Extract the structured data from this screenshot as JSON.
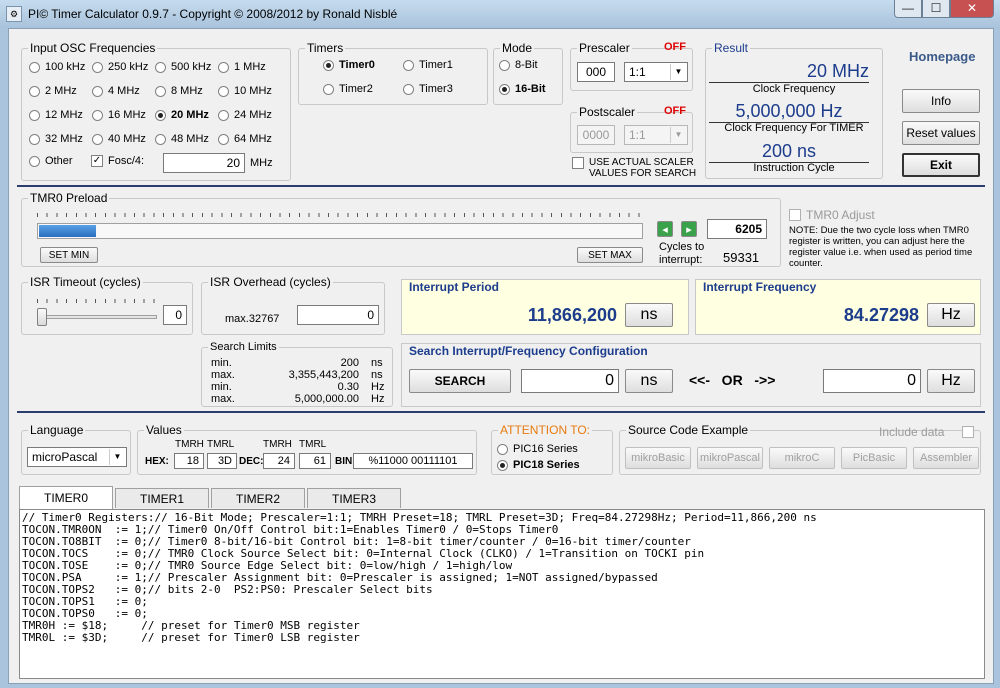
{
  "window": {
    "title": "PI© Timer Calculator 0.9.7 - Copyright © 2008/2012 by Ronald Nisblé",
    "min": "—",
    "max": "☐",
    "close": "✕"
  },
  "osc": {
    "legend": "Input OSC Frequencies",
    "options": [
      "100 kHz",
      "250 kHz",
      "500 kHz",
      "1 MHz",
      "2 MHz",
      "4 MHz",
      "8 MHz",
      "10 MHz",
      "12 MHz",
      "16 MHz",
      "20 MHz",
      "24 MHz",
      "32 MHz",
      "40 MHz",
      "48 MHz",
      "64 MHz"
    ],
    "selected": "20 MHz",
    "other_label": "Other",
    "fosc_label": "Fosc/4:",
    "fosc_checked": true,
    "other_value": "20",
    "other_unit": "MHz"
  },
  "timers": {
    "legend": "Timers",
    "options": [
      "Timer0",
      "Timer1",
      "Timer2",
      "Timer3"
    ],
    "selected": "Timer0"
  },
  "mode": {
    "legend": "Mode",
    "options": [
      "8-Bit",
      "16-Bit"
    ],
    "selected": "16-Bit"
  },
  "prescaler": {
    "legend": "Prescaler",
    "state": "OFF",
    "value": "000",
    "ratio": "1:1"
  },
  "postscaler": {
    "legend": "Postscaler",
    "state": "OFF",
    "value": "0000",
    "ratio": "1:1"
  },
  "use_actual": {
    "line1": "USE ACTUAL SCALER",
    "line2": "VALUES FOR SEARCH"
  },
  "result": {
    "legend": "Result",
    "clock_value": "20",
    "clock_unit": "MHz",
    "clock_label": "Clock Frequency",
    "timer_clock_value": "5,000,000",
    "timer_clock_unit": "Hz",
    "timer_clock_label": "Clock Frequency For TIMER",
    "cycle_value": "200",
    "cycle_unit": "ns",
    "cycle_label": "Instruction Cycle"
  },
  "side": {
    "homepage": "Homepage",
    "info": "Info",
    "reset": "Reset values",
    "exit": "Exit"
  },
  "preload": {
    "legend": "TMR0 Preload",
    "set_min": "SET MIN",
    "set_max": "SET MAX",
    "value": "6205",
    "level": 0.0947,
    "cycles_label1": "Cycles to",
    "cycles_label2": "interrupt:",
    "cycles_value": "59331"
  },
  "adjust": {
    "label": "TMR0 Adjust",
    "note": "NOTE: Due the two cycle loss when TMR0 register is written, you can adjust here the register value i.e. when used as period time counter."
  },
  "isr_timeout": {
    "legend": "ISR Timeout (cycles)",
    "value": "0",
    "level": 0.0
  },
  "isr_overhead": {
    "legend": "ISR Overhead  (cycles)",
    "max_label": "max.32767",
    "value": "0"
  },
  "search_limits": {
    "legend": "Search Limits",
    "rows": [
      {
        "label": "min.",
        "value": "200",
        "unit": "ns"
      },
      {
        "label": "max.",
        "value": "3,355,443,200",
        "unit": "ns"
      },
      {
        "label": "min.",
        "value": "0.30",
        "unit": "Hz"
      },
      {
        "label": "max.",
        "value": "5,000,000.00",
        "unit": "Hz"
      }
    ]
  },
  "interrupt_period": {
    "title": "Interrupt Period",
    "value": "11,866,200",
    "unit": "ns"
  },
  "interrupt_frequency": {
    "title": "Interrupt Frequency",
    "value": "84.27298",
    "unit": "Hz"
  },
  "search_config": {
    "title": "Search Interrupt/Frequency Configuration",
    "search": "SEARCH",
    "period_value": "0",
    "period_unit": "ns",
    "arrows": "<<-   OR   ->>",
    "freq_value": "0",
    "freq_unit": "Hz"
  },
  "language": {
    "legend": "Language",
    "value": "microPascal"
  },
  "values": {
    "legend": "Values",
    "tmrh_label": "TMRH",
    "tmrl_label": "TMRL",
    "hex_label": "HEX:",
    "hex_h": "18",
    "hex_l": "3D",
    "dec_label": "DEC:",
    "dec_h": "24",
    "dec_l": "61",
    "bin_label": "BIN:",
    "bin_value": "%11000 00111101"
  },
  "attention": {
    "legend": "ATTENTION TO:",
    "options": [
      "PIC16 Series",
      "PIC18 Series"
    ],
    "selected": "PIC18 Series"
  },
  "source": {
    "legend": "Source Code Example",
    "include": "Include data",
    "buttons": [
      "mikroBasic",
      "mikroPascal",
      "mikroC",
      "PicBasic",
      "Assembler"
    ]
  },
  "tabs": [
    "TIMER0",
    "TIMER1",
    "TIMER2",
    "TIMER3"
  ],
  "active_tab": "TIMER0",
  "code_lines": [
    "// Timer0 Registers:// 16-Bit Mode; Prescaler=1:1; TMRH Preset=18; TMRL Preset=3D; Freq=84.27298Hz; Period=11,866,200 ns",
    "TOCON.TMR0ON  := 1;// Timer0 On/Off Control bit:1=Enables Timer0 / 0=Stops Timer0",
    "TOCON.TO8BIT  := 0;// Timer0 8-bit/16-bit Control bit: 1=8-bit timer/counter / 0=16-bit timer/counter",
    "TOCON.TOCS    := 0;// TMR0 Clock Source Select bit: 0=Internal Clock (CLKO) / 1=Transition on TOCKI pin",
    "TOCON.TOSE    := 0;// TMR0 Source Edge Select bit: 0=low/high / 1=high/low",
    "TOCON.PSA     := 1;// Prescaler Assignment bit: 0=Prescaler is assigned; 1=NOT assigned/bypassed",
    "TOCON.TOPS2   := 0;// bits 2-0  PS2:PS0: Prescaler Select bits",
    "TOCON.TOPS1   := 0;",
    "TOCON.TOPS0   := 0;",
    "TMR0H := $18;     // preset for Timer0 MSB register",
    "TMR0L := $3D;     // preset for Timer0 LSB register"
  ]
}
